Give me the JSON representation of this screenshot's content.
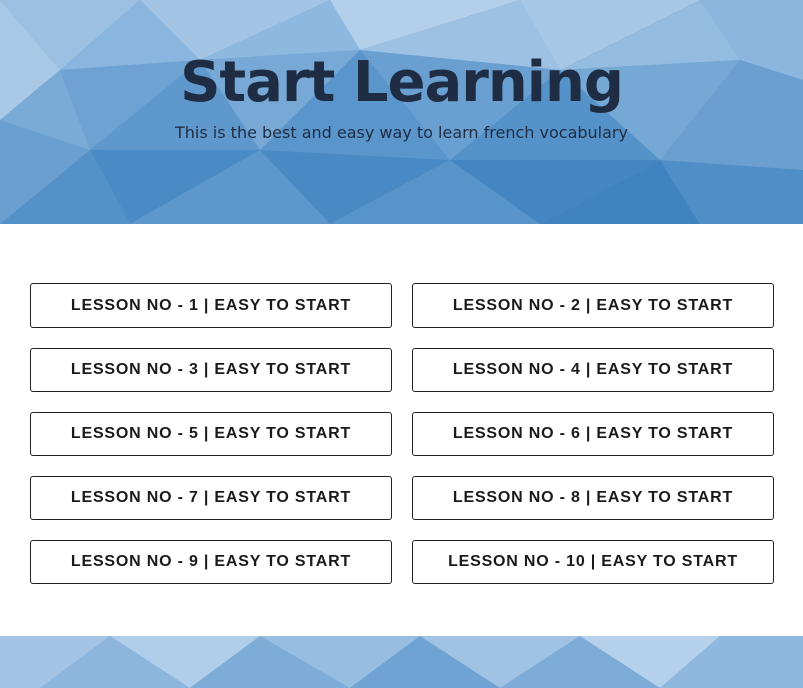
{
  "hero": {
    "title": "Start Learning",
    "subtitle": "This is the best and easy way to learn french vocabulary"
  },
  "lessons": [
    {
      "label": "LESSON NO - 1 | EASY TO START"
    },
    {
      "label": "LESSON NO - 2 | EASY TO START"
    },
    {
      "label": "LESSON NO - 3 | EASY TO START"
    },
    {
      "label": "LESSON NO - 4 | EASY TO START"
    },
    {
      "label": "LESSON NO - 5 | EASY TO START"
    },
    {
      "label": "LESSON NO - 6 | EASY TO START"
    },
    {
      "label": "LESSON NO - 7 | EASY TO START"
    },
    {
      "label": "LESSON NO - 8 | EASY TO START"
    },
    {
      "label": "LESSON NO - 9 | EASY TO START"
    },
    {
      "label": "LESSON NO - 10 | EASY TO START"
    }
  ],
  "colors": {
    "hero_background": "#6fa3d3",
    "title_text": "#1f2d44",
    "button_border": "#222222"
  }
}
